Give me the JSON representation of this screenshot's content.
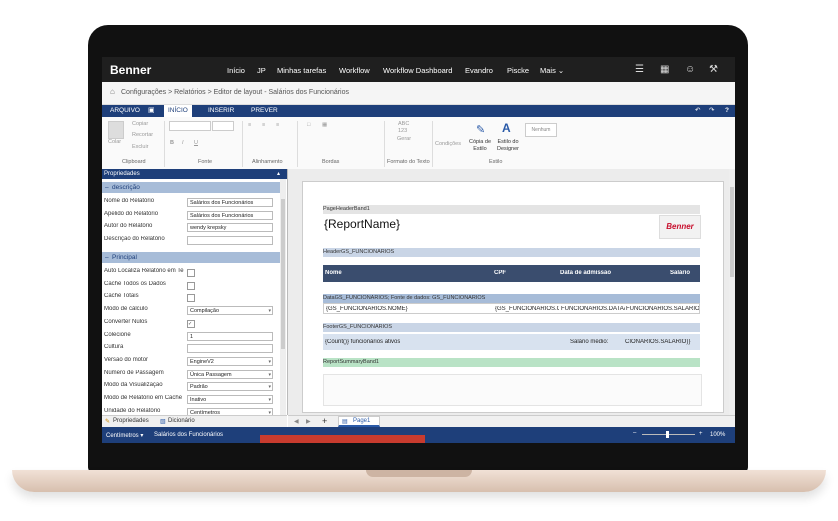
{
  "nav": {
    "logo": "Benner",
    "items": [
      "Início",
      "JP",
      "Minhas tarefas",
      "Workflow",
      "Workflow Dashboard",
      "Evandro",
      "Piscke",
      "Mais ⌄"
    ]
  },
  "breadcrumb": {
    "path": "Configurações  >  Relatórios  >  Editor de layout - Salários dos Funcionários"
  },
  "tabs": [
    "ARQUIVO",
    "INÍCIO",
    "INSERIR",
    "PREVER"
  ],
  "ribbon": {
    "clipboard_colar": "Colar",
    "clipboard_copiar": "Copiar",
    "clipboard_recortar": "Recortar",
    "clipboard_excluir": "Excluir",
    "groups": {
      "clipboard": "Clipboard",
      "fonte": "Fonte",
      "alinhamento": "Alinhamento",
      "bordas": "Bordas",
      "formato_texto": "Formato do Texto",
      "estilo": "Estilo"
    },
    "gerar_abc": "ABC",
    "gerar_num": "123",
    "gerar": "Gerar",
    "condicoes": "Condições",
    "copia_estilo": "Cópia de Estilo",
    "estilo_designer": "Estilo do Designer",
    "nenhum": "Nenhum"
  },
  "left_panel": {
    "title": "Propriedades",
    "section_descricao": "descrição",
    "section_principal": "Principal",
    "descricao_rows": [
      {
        "label": "Nome do Relatório",
        "value": "Salários dos Funcionários"
      },
      {
        "label": "Apelido do Relatório",
        "value": "Salários dos Funcionários"
      },
      {
        "label": "Autor do Relatório",
        "value": "wendy krepsky"
      },
      {
        "label": "Descrição do Relatório",
        "value": ""
      }
    ],
    "principal_rows": [
      {
        "label": "Auto Localiza Relatório em Te",
        "type": "check",
        "value": ""
      },
      {
        "label": "Cache Todos os Dados",
        "type": "check",
        "value": ""
      },
      {
        "label": "Cache Totais",
        "type": "check",
        "value": ""
      },
      {
        "label": "Modo de cálculo",
        "type": "select",
        "value": "Compilação"
      },
      {
        "label": "Converter Nulos",
        "type": "check-on",
        "value": "✓"
      },
      {
        "label": "Colecione",
        "type": "text",
        "value": "1"
      },
      {
        "label": "Cultura",
        "type": "text",
        "value": ""
      },
      {
        "label": "Versão do motor",
        "type": "select",
        "value": "EngineV2"
      },
      {
        "label": "Número de Passagem",
        "type": "select",
        "value": "Única Passagem"
      },
      {
        "label": "Modo da Visualização",
        "type": "select",
        "value": "Padrão"
      },
      {
        "label": "Modo de Relatório em Cache",
        "type": "select",
        "value": "Inativo"
      },
      {
        "label": "Unidade do Relatório",
        "type": "select",
        "value": "Centímetros"
      }
    ],
    "tab_propriedades": "Propriedades",
    "tab_dicionario": "Dicionário"
  },
  "report": {
    "page_header_band": "PageHeaderBand1",
    "report_name": "{ReportName}",
    "header_band": "HeaderGS_FUNCIONARIOS",
    "columns": [
      "Nome",
      "CPF",
      "Data de admissão",
      "Salário"
    ],
    "data_band": "DataGS_FUNCIONARIOS; Fonte de dados: GS_FUNCIONARIOS",
    "data_cells": [
      "{GS_FUNCIONARIOS.NOME}",
      "{GS_FUNCIONARIOS.CP",
      "FUNCIONARIOS.DATAADM",
      "FUNCIONARIOS.SALARIO}"
    ],
    "footer_band": "FooterGS_FUNCIONARIOS",
    "footer_count": "{Count()} funcionários ativos",
    "footer_avg_label": "Salário médio:",
    "footer_avg_value": "CIONARIOS.SALARIO)}",
    "summary_band": "ReportSummaryBand1",
    "logo_text": "Benner"
  },
  "pagebar": {
    "add": "+",
    "page_tab": "Page1"
  },
  "status": {
    "unit": "Centímetros ▾",
    "report": "Salários dos Funcionários",
    "zoom": "100%"
  },
  "colors": {
    "nav_bg": "#1f1f1f",
    "accent": "#1e3f7a",
    "section": "#a7bcd8",
    "header_col": "#3a4d6e",
    "band_light": "#c9d5e6",
    "summary_band": "#b9e3c6",
    "logo_red": "#c8102e"
  }
}
